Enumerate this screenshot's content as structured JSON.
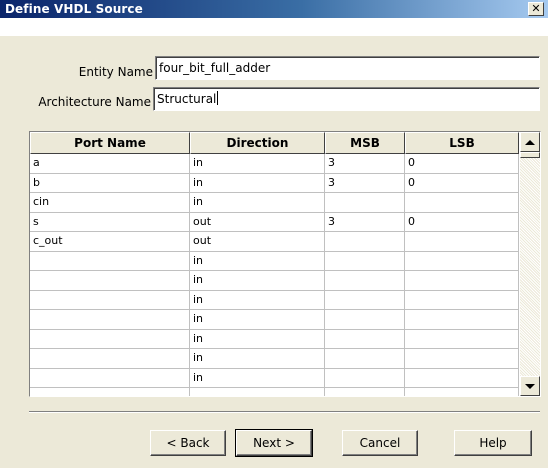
{
  "window": {
    "title": "Define VHDL Source",
    "close_glyph": "✕"
  },
  "form": {
    "entity_label": "Entity Name",
    "entity_value": "four_bit_full_adder",
    "arch_label": "Architecture Name",
    "arch_value": "Structural"
  },
  "ports": {
    "headers": [
      "Port Name",
      "Direction",
      "MSB",
      "LSB"
    ],
    "rows": [
      [
        "a",
        "in",
        "3",
        "0"
      ],
      [
        "b",
        "in",
        "3",
        "0"
      ],
      [
        "cin",
        "in",
        "",
        ""
      ],
      [
        "s",
        "out",
        "3",
        "0"
      ],
      [
        "c_out",
        "out",
        "",
        ""
      ],
      [
        "",
        "in",
        "",
        ""
      ],
      [
        "",
        "in",
        "",
        ""
      ],
      [
        "",
        "in",
        "",
        ""
      ],
      [
        "",
        "in",
        "",
        ""
      ],
      [
        "",
        "in",
        "",
        ""
      ],
      [
        "",
        "in",
        "",
        ""
      ],
      [
        "",
        "in",
        "",
        ""
      ],
      [
        "",
        "",
        "",
        ""
      ]
    ]
  },
  "buttons": {
    "back": "< Back",
    "next": "Next >",
    "cancel": "Cancel",
    "help": "Help"
  },
  "colors": {
    "titlebar_start": "#0a246a",
    "titlebar_end": "#a6caf0",
    "dialog_bg": "#ece9d8"
  }
}
